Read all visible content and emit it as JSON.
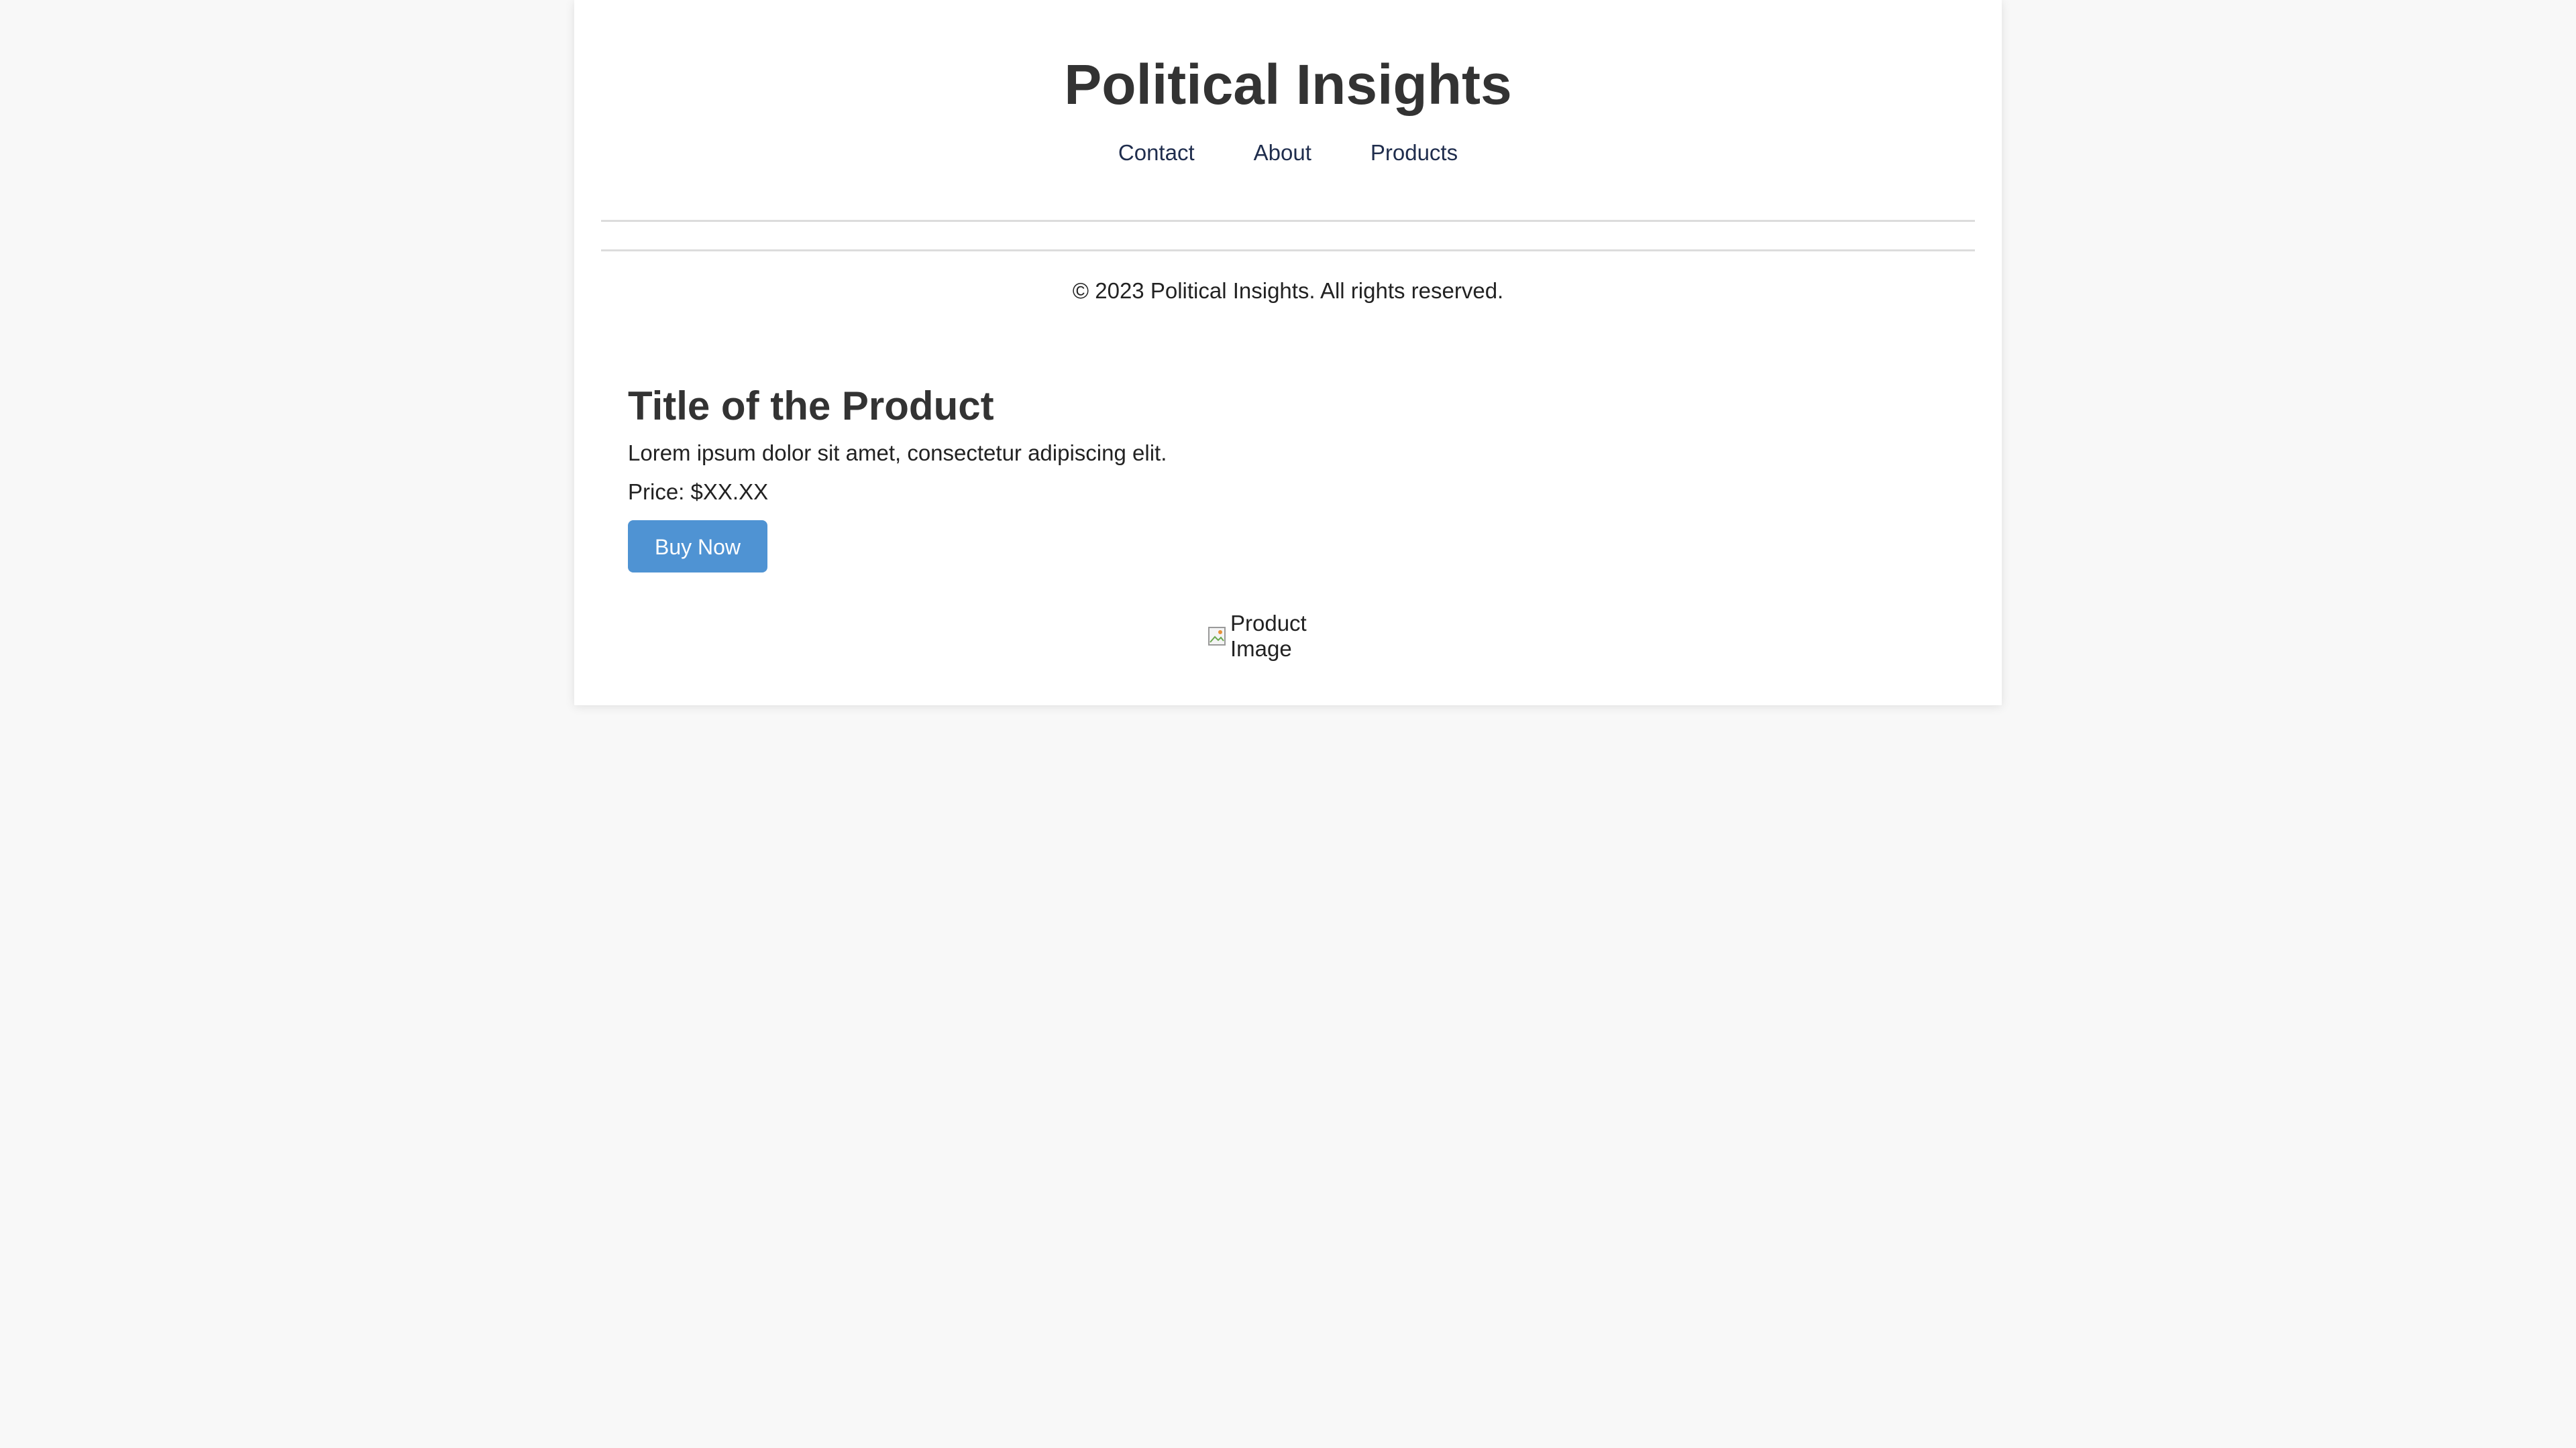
{
  "header": {
    "site_title": "Political Insights",
    "nav": [
      {
        "label": "Contact"
      },
      {
        "label": "About"
      },
      {
        "label": "Products"
      }
    ]
  },
  "footer": {
    "copyright": "© 2023 Political Insights. All rights reserved."
  },
  "product": {
    "title": "Title of the Product",
    "description": "Lorem ipsum dolor sit amet, consectetur adipiscing elit.",
    "price": "Price: $XX.XX",
    "buy_label": "Buy Now",
    "image_alt": "Product Image",
    "image_icon": "broken-image-icon"
  },
  "colors": {
    "page_background": "#f8f8f8",
    "card_background": "#ffffff",
    "button": "#4f93d3",
    "nav_link": "#1f2d4d",
    "title_text": "#333333"
  }
}
